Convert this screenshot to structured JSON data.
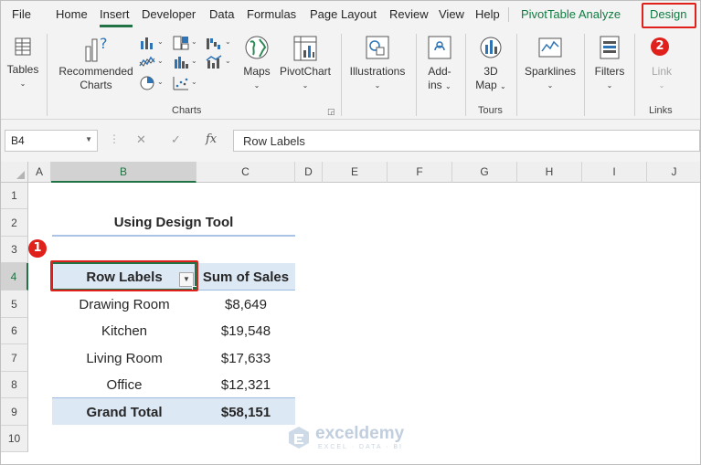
{
  "tabs": {
    "items": [
      "File",
      "Home",
      "Insert",
      "Developer",
      "Data",
      "Formulas",
      "Page Layout",
      "Review",
      "View",
      "Help"
    ],
    "pivot_analyze": "PivotTable Analyze",
    "design": "Design",
    "active": "Insert"
  },
  "ribbon": {
    "tables": "Tables",
    "recommended_charts_1": "Recommended",
    "recommended_charts_2": "Charts",
    "maps": "Maps",
    "pivotchart": "PivotChart",
    "charts_group": "Charts",
    "illustrations": "Illustrations",
    "addins_1": "Add-",
    "addins_2": "ins",
    "map3d_1": "3D",
    "map3d_2": "Map",
    "tours_group": "Tours",
    "sparklines": "Sparklines",
    "filters": "Filters",
    "link": "Link",
    "links_group": "Links"
  },
  "badges": {
    "one": "1",
    "two": "2"
  },
  "formula_bar": {
    "name_box": "B4",
    "cancel": "✕",
    "enter": "✓",
    "fx": "fx",
    "content": "Row Labels"
  },
  "columns": [
    "A",
    "B",
    "C",
    "D",
    "E",
    "F",
    "G",
    "H",
    "I",
    "J"
  ],
  "rows": [
    "1",
    "2",
    "3",
    "4",
    "5",
    "6",
    "7",
    "8",
    "9",
    "10"
  ],
  "sheet": {
    "title": "Using Design Tool",
    "header_row_labels": "Row Labels",
    "header_sum": "Sum of Sales",
    "rows": [
      {
        "label": "Drawing Room",
        "value": "$8,649"
      },
      {
        "label": "Kitchen",
        "value": "$19,548"
      },
      {
        "label": "Living Room",
        "value": "$17,633"
      },
      {
        "label": "Office",
        "value": "$12,321"
      }
    ],
    "total_label": "Grand Total",
    "total_value": "$58,151"
  },
  "watermark": {
    "name": "exceldemy",
    "tagline": "EXCEL · DATA · BI"
  },
  "colors": {
    "accent_red": "#e0201b",
    "excel_green": "#217346",
    "pivot_band": "#dde8f5"
  }
}
